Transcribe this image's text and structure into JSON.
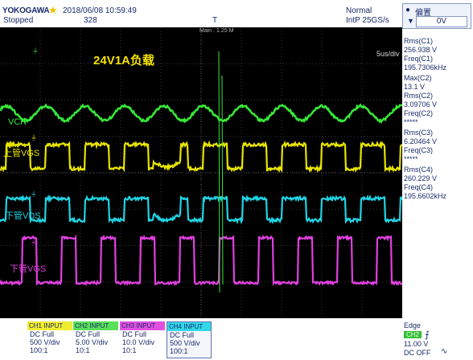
{
  "header": {
    "brand": "YOKOGAWA",
    "datetime": "2018/06/08 10:59:49",
    "status": "Stopped",
    "count": "328",
    "trigger_position_marker": "T",
    "acquisition_mode": "Normal",
    "acquisition_rate": "IntP  25GS/s"
  },
  "offset_panel": {
    "label": "偏置",
    "value": "0V"
  },
  "display": {
    "timebase_label": "Main : 1.25 M",
    "time_per_div": "5us/div",
    "annotation": "24V1A负载",
    "labels": {
      "vcr": "VCR",
      "high_vgs": "上管VGS",
      "low_vds": "下管VDS",
      "low_vgs": "下管VGS"
    },
    "colors": {
      "ch1": "#e8e400",
      "ch2": "#38e838",
      "ch3": "#e040e0",
      "ch4": "#20d4e4"
    }
  },
  "measurements": [
    "Rms(C1)",
    "256.938 V",
    "Freq(C1)",
    "195.7306kHz",
    "Max(C2)",
    "13.1 V",
    "Rms(C2)",
    "3.09706 V",
    "Freq(C2)",
    "*****",
    "Rms(C3)",
    "6.20464 V",
    "Freq(C3)",
    "*****",
    "Rms(C4)",
    "260.229 V",
    "Freq(C4)",
    "195.6602kHz"
  ],
  "channels": [
    {
      "title": "CH1 INPUT",
      "coupling": "DC Full",
      "scale": "500 V/div",
      "probe": "100:1",
      "color": "#f0ec30"
    },
    {
      "title": "CH2 INPUT",
      "coupling": "DC Full",
      "scale": "5.00 V/div",
      "probe": "10:1",
      "color": "#58e058"
    },
    {
      "title": "CH3 INPUT",
      "coupling": "DC Full",
      "scale": "10.0 V/div",
      "probe": "10:1",
      "color": "#e050e0"
    },
    {
      "title": "CH4 INPUT",
      "coupling": "DC Full",
      "scale": "500 V/div",
      "probe": "100:1",
      "color": "#30d8e8"
    }
  ],
  "trigger": {
    "type": "Edge",
    "source": "CH2",
    "level": "11.00 V",
    "coupling": "DC OFF"
  },
  "icons": {
    "star": "star-icon",
    "offset": "offset-dial-icon",
    "edge": "rising-edge-icon",
    "hf": "hf-reject-icon"
  }
}
